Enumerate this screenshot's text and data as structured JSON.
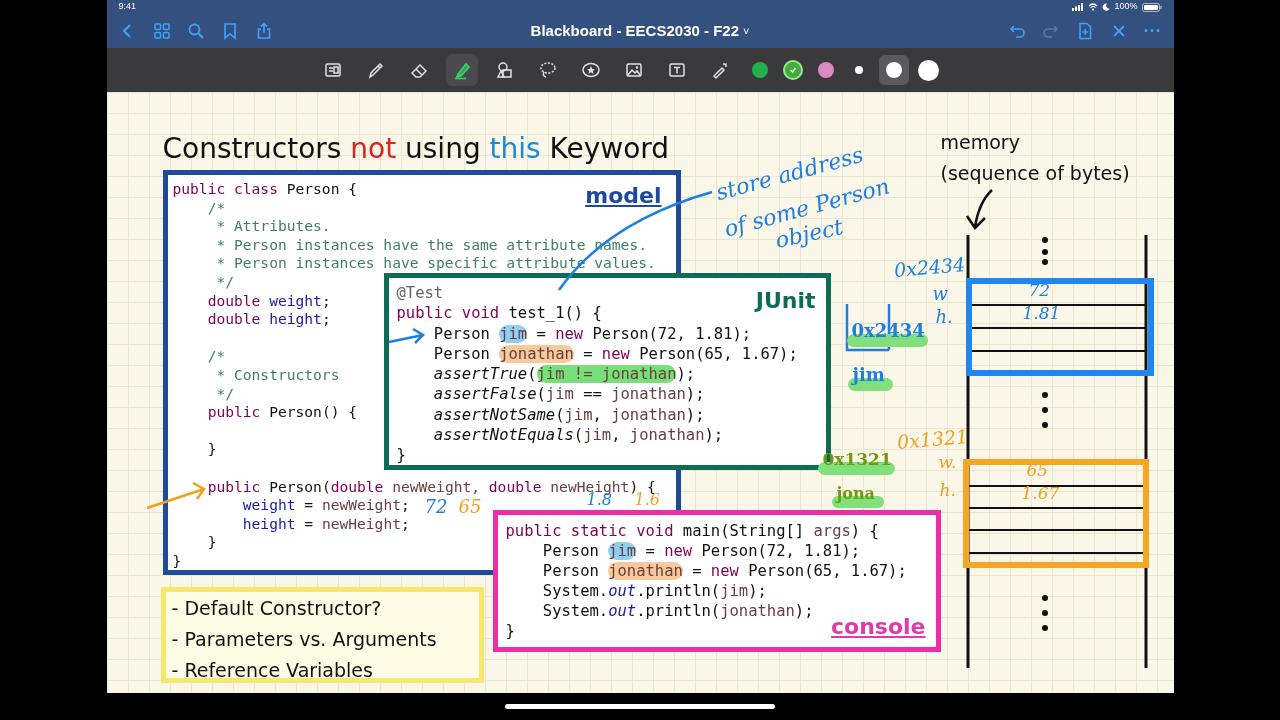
{
  "status_bar": {
    "time": "9:41",
    "battery": "100%"
  },
  "nav": {
    "title": "Blackboard - EECS2030 - F22",
    "title_caret": "˅",
    "more": "···"
  },
  "toolbar": {
    "tools": [
      {
        "selected": false
      },
      {
        "selected": false
      },
      {
        "selected": false
      },
      {
        "selected": true
      },
      {
        "selected": false
      },
      {
        "selected": false
      },
      {
        "selected": false
      },
      {
        "selected": false
      },
      {
        "selected": false
      },
      {
        "selected": false
      }
    ],
    "colors": [
      {
        "color": "#22b24c",
        "selected": false
      },
      {
        "color": "#3fae3a",
        "selected": true
      },
      {
        "color": "#d98ac0",
        "selected": false
      }
    ],
    "sizes": [
      {
        "selected": false
      },
      {
        "selected": true
      },
      {
        "selected": false
      }
    ]
  },
  "slide": {
    "title": [
      {
        "text": "Constructors ",
        "color": "#111111"
      },
      {
        "text": "not",
        "color": "#d9261c"
      },
      {
        "text": " using ",
        "color": "#111111"
      },
      {
        "text": "this",
        "color": "#1c8ad8"
      },
      {
        "text": " Keyword",
        "color": "#111111"
      }
    ],
    "model": {
      "label": "model",
      "lines": [
        {
          "segments": [
            {
              "text": "public class",
              "kind": "k"
            },
            {
              "text": " Person {",
              "kind": "p"
            }
          ]
        },
        {
          "segments": [
            {
              "text": "    /*",
              "kind": "c"
            }
          ]
        },
        {
          "segments": [
            {
              "text": "     * Attributes.",
              "kind": "c"
            }
          ]
        },
        {
          "segments": [
            {
              "text": "     * Person instances have the same attribute names.",
              "kind": "c"
            }
          ]
        },
        {
          "segments": [
            {
              "text": "     * Person instances have specific attribute values.",
              "kind": "c"
            }
          ]
        },
        {
          "segments": [
            {
              "text": "     */",
              "kind": "c"
            }
          ]
        },
        {
          "segments": [
            {
              "text": "    double",
              "kind": "k"
            },
            {
              "text": " weight",
              "kind": "f"
            },
            {
              "text": ";",
              "kind": "p"
            }
          ]
        },
        {
          "segments": [
            {
              "text": "    double",
              "kind": "k"
            },
            {
              "text": " height",
              "kind": "f"
            },
            {
              "text": ";",
              "kind": "p"
            }
          ]
        },
        {
          "kind": "blank"
        },
        {
          "segments": [
            {
              "text": "    /*",
              "kind": "c"
            }
          ]
        },
        {
          "segments": [
            {
              "text": "     * Constructors",
              "kind": "c"
            }
          ]
        },
        {
          "segments": [
            {
              "text": "     */",
              "kind": "c"
            }
          ]
        },
        {
          "segments": [
            {
              "text": "    public",
              "kind": "k"
            },
            {
              "text": " Person() {",
              "kind": "p"
            }
          ]
        },
        {
          "kind": "blank"
        },
        {
          "segments": [
            {
              "text": "    }",
              "kind": "p"
            }
          ]
        },
        {
          "kind": "blank"
        },
        {
          "segments": [
            {
              "text": "    public",
              "kind": "k"
            },
            {
              "text": " Person(",
              "kind": "p"
            },
            {
              "text": "double",
              "kind": "k"
            },
            {
              "text": " newWeight, ",
              "kind": "v"
            },
            {
              "text": "double",
              "kind": "k"
            },
            {
              "text": " newHeight",
              "kind": "v"
            },
            {
              "text": ") {",
              "kind": "p"
            }
          ]
        },
        {
          "segments": [
            {
              "text": "        weight",
              "kind": "f"
            },
            {
              "text": " = ",
              "kind": "p"
            },
            {
              "text": "newWeight",
              "kind": "v"
            },
            {
              "text": ";",
              "kind": "p"
            }
          ]
        },
        {
          "segments": [
            {
              "text": "        height",
              "kind": "f"
            },
            {
              "text": " = ",
              "kind": "p"
            },
            {
              "text": "newHeight",
              "kind": "v"
            },
            {
              "text": ";",
              "kind": "p"
            }
          ]
        },
        {
          "segments": [
            {
              "text": "    }",
              "kind": "p"
            }
          ]
        },
        {
          "segments": [
            {
              "text": "}",
              "kind": "p"
            }
          ]
        }
      ]
    },
    "junit": {
      "label": "JUnit",
      "lines": [
        {
          "segments": [
            {
              "text": "@Test",
              "kind": "a"
            }
          ]
        },
        {
          "segments": [
            {
              "text": "public void",
              "kind": "k"
            },
            {
              "text": " test_1() {",
              "kind": "p"
            }
          ]
        },
        {
          "segments": [
            {
              "text": "    Person ",
              "kind": "p"
            },
            {
              "text": "jim",
              "kind": "hb"
            },
            {
              "text": " = ",
              "kind": "p"
            },
            {
              "text": "new",
              "kind": "k"
            },
            {
              "text": " Person(72, 1.81);",
              "kind": "p"
            }
          ]
        },
        {
          "segments": [
            {
              "text": "    Person ",
              "kind": "p"
            },
            {
              "text": "jonathan",
              "kind": "ho"
            },
            {
              "text": " = ",
              "kind": "p"
            },
            {
              "text": "new",
              "kind": "k"
            },
            {
              "text": " Person(65, 1.67);",
              "kind": "p"
            }
          ]
        },
        {
          "segments": [
            {
              "text": "    assertTrue",
              "kind": "m"
            },
            {
              "text": "(",
              "kind": "p"
            },
            {
              "text": "jim != jonathan",
              "kind": "hg"
            },
            {
              "text": ");",
              "kind": "p"
            }
          ]
        },
        {
          "segments": [
            {
              "text": "    assertFalse",
              "kind": "m"
            },
            {
              "text": "(",
              "kind": "p"
            },
            {
              "text": "jim",
              "kind": "v"
            },
            {
              "text": " == ",
              "kind": "p"
            },
            {
              "text": "jonathan",
              "kind": "v"
            },
            {
              "text": ");",
              "kind": "p"
            }
          ]
        },
        {
          "segments": [
            {
              "text": "    assertNotSame",
              "kind": "m"
            },
            {
              "text": "(",
              "kind": "p"
            },
            {
              "text": "jim",
              "kind": "v"
            },
            {
              "text": ", ",
              "kind": "p"
            },
            {
              "text": "jonathan",
              "kind": "v"
            },
            {
              "text": ");",
              "kind": "p"
            }
          ]
        },
        {
          "segments": [
            {
              "text": "    assertNotEquals",
              "kind": "m"
            },
            {
              "text": "(",
              "kind": "p"
            },
            {
              "text": "jim",
              "kind": "v"
            },
            {
              "text": ", ",
              "kind": "p"
            },
            {
              "text": "jonathan",
              "kind": "v"
            },
            {
              "text": ");",
              "kind": "p"
            }
          ]
        },
        {
          "segments": [
            {
              "text": "}",
              "kind": "p"
            }
          ]
        }
      ]
    },
    "console": {
      "label": "console",
      "lines": [
        {
          "segments": [
            {
              "text": "public static void",
              "kind": "k"
            },
            {
              "text": " main(String[] ",
              "kind": "p"
            },
            {
              "text": "args",
              "kind": "v"
            },
            {
              "text": ") {",
              "kind": "p"
            }
          ]
        },
        {
          "segments": [
            {
              "text": "    Person ",
              "kind": "p"
            },
            {
              "text": "jim",
              "kind": "hb"
            },
            {
              "text": " = ",
              "kind": "p"
            },
            {
              "text": "new",
              "kind": "k"
            },
            {
              "text": " Person(72, 1.81);",
              "kind": "p"
            }
          ]
        },
        {
          "segments": [
            {
              "text": "    Person ",
              "kind": "p"
            },
            {
              "text": "jonathan",
              "kind": "ho"
            },
            {
              "text": " = ",
              "kind": "p"
            },
            {
              "text": "new",
              "kind": "k"
            },
            {
              "text": " Person(65, 1.67);",
              "kind": "p"
            }
          ]
        },
        {
          "segments": [
            {
              "text": "    System.",
              "kind": "p"
            },
            {
              "text": "out",
              "kind": "s"
            },
            {
              "text": ".println(",
              "kind": "p"
            },
            {
              "text": "jim",
              "kind": "v"
            },
            {
              "text": ");",
              "kind": "p"
            }
          ]
        },
        {
          "segments": [
            {
              "text": "    System.",
              "kind": "p"
            },
            {
              "text": "out",
              "kind": "s"
            },
            {
              "text": ".println(",
              "kind": "p"
            },
            {
              "text": "jonathan",
              "kind": "v"
            },
            {
              "text": ");",
              "kind": "p"
            }
          ]
        },
        {
          "segments": [
            {
              "text": "}",
              "kind": "p"
            }
          ]
        }
      ]
    },
    "bullets": [
      "- Default Constructor?",
      "- Parameters vs. Arguments",
      "- Reference Variables"
    ],
    "memory": {
      "title": "memory",
      "subtitle": "(sequence of bytes)"
    },
    "ink_notes": [
      {
        "text": "store address",
        "color": "#1e7fe0",
        "highlighted": false
      },
      {
        "text": "of some Person",
        "color": "#1e7fe0",
        "highlighted": false
      },
      {
        "text": "object",
        "color": "#1e7fe0",
        "highlighted": false
      },
      {
        "text": "0x2434",
        "color": "#1e7fe0",
        "highlighted": false
      },
      {
        "text": "w",
        "color": "#1e7fe0",
        "highlighted": false
      },
      {
        "text": "72",
        "color": "#1e7fe0",
        "highlighted": false
      },
      {
        "text": "h.",
        "color": "#1e7fe0",
        "highlighted": false
      },
      {
        "text": "1.81",
        "color": "#1e7fe0",
        "highlighted": false
      },
      {
        "text": "0x2434",
        "color": "#1e7fe0",
        "highlighted": true
      },
      {
        "text": "jim",
        "color": "#1e7fe0",
        "highlighted": true
      },
      {
        "text": "0x1321",
        "color": "#f0a020",
        "highlighted": false
      },
      {
        "text": "0x1321",
        "color": "#6f9a10",
        "highlighted": true
      },
      {
        "text": "w.",
        "color": "#f0a020",
        "highlighted": false
      },
      {
        "text": "65",
        "color": "#f0a020",
        "highlighted": false
      },
      {
        "text": "72",
        "color": "#1e7fe0",
        "highlighted": false
      },
      {
        "text": "65",
        "color": "#f0a020",
        "highlighted": false
      },
      {
        "text": "1.8",
        "color": "#1e7fe0",
        "highlighted": false
      },
      {
        "text": "1.6",
        "color": "#f0a020",
        "highlighted": false
      },
      {
        "text": "jona",
        "color": "#6f9a10",
        "highlighted": true
      },
      {
        "text": "h.",
        "color": "#f0a020",
        "highlighted": false
      },
      {
        "text": "1.67",
        "color": "#f0a020",
        "highlighted": false
      }
    ]
  }
}
